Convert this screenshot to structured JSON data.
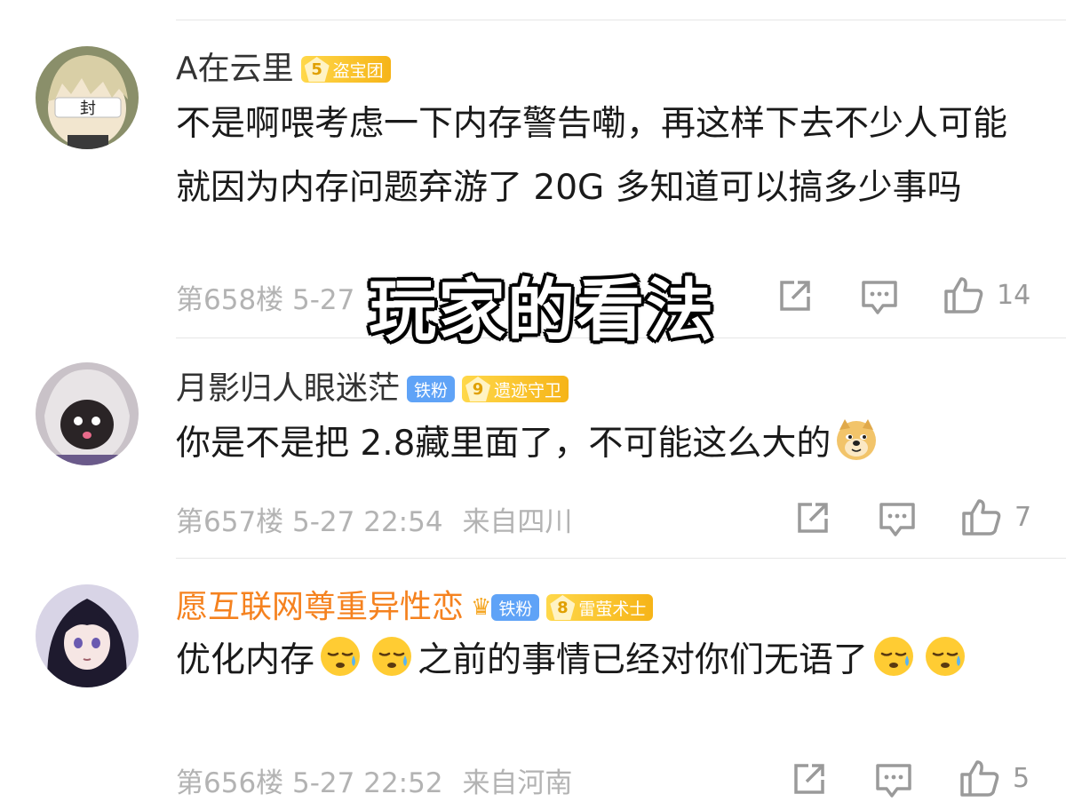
{
  "comments": [
    {
      "username": "A在云里",
      "username_color": "#333333",
      "level": "5",
      "level_title": "盗宝团",
      "text": "不是啊喂考虑一下内存警告嘞，再这样下去不少人可能就因为内存问题弃游了 20G 多知道可以搞多少事吗",
      "floor_time": "第658楼 5-27",
      "like_count": "14"
    },
    {
      "username": "月影归人眼迷茫",
      "username_color": "#333333",
      "fan_badge": "铁粉",
      "level": "9",
      "level_title": "遗迹守卫",
      "text": "你是不是把 2.8藏里面了，不可能这么大的",
      "emoji": "doge-emoji",
      "floor_time": "第657楼 5-27 22:54",
      "location": "来自四川",
      "like_count": "7"
    },
    {
      "username": "愿互联网尊重异性恋",
      "username_color": "#f5821f",
      "crown_icon": "crown-icon",
      "fan_badge": "铁粉",
      "level": "8",
      "level_title": "雷萤术士",
      "text_part1": "优化内存",
      "text_part2": "之前的事情已经对你们无语了",
      "emoji": "sweat-emoji",
      "floor_time": "第656楼 5-27 22:52",
      "location": "来自河南",
      "like_count": "5"
    }
  ],
  "overlay_title": "玩家的看法",
  "icons": [
    "share-icon",
    "reply-icon",
    "like-icon"
  ]
}
